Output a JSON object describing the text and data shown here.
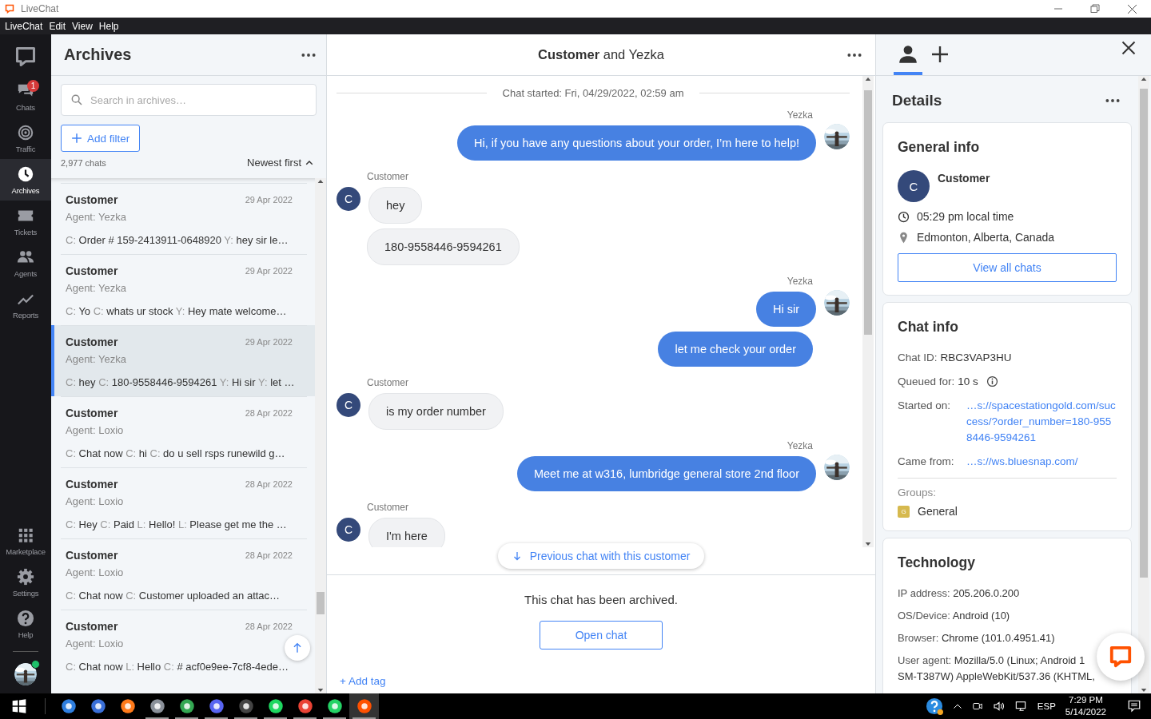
{
  "window": {
    "title": "LiveChat"
  },
  "menu": [
    "LiveChat",
    "Edit",
    "View",
    "Help"
  ],
  "nav": {
    "top": [
      {
        "kind": "chats",
        "label": "Chats",
        "selected": false,
        "badge": "1"
      },
      {
        "kind": "traffic",
        "label": "Traffic",
        "selected": false
      },
      {
        "kind": "archives",
        "label": "Archives",
        "selected": true
      },
      {
        "kind": "tickets",
        "label": "Tickets",
        "selected": false
      },
      {
        "kind": "agents",
        "label": "Agents",
        "selected": false
      },
      {
        "kind": "reports",
        "label": "Reports",
        "selected": false
      }
    ],
    "bottom": [
      {
        "kind": "marketplace",
        "label": "Marketplace",
        "selected": false
      },
      {
        "kind": "settings",
        "label": "Settings",
        "selected": false
      },
      {
        "kind": "help",
        "label": "Help",
        "selected": false
      }
    ],
    "agent_online": true
  },
  "archives": {
    "title": "Archives",
    "search_placeholder": "Search in archives…",
    "filter_button": "Add filter",
    "count": "2,977 chats",
    "sort": "Newest first",
    "items": [
      {
        "name": "Customer",
        "date": "29 Apr 2022",
        "agent": "Agent: Yezka",
        "selected": false,
        "preview": [
          {
            "who": "C:",
            "text": "Order # 159-2413911-0648920"
          },
          {
            "who": "Y:",
            "text": "hey sir le…"
          }
        ]
      },
      {
        "name": "Customer",
        "date": "29 Apr 2022",
        "agent": "Agent: Yezka",
        "selected": false,
        "preview": [
          {
            "who": "C:",
            "text": "Yo"
          },
          {
            "who": "C:",
            "text": "whats ur stock"
          },
          {
            "who": "Y:",
            "text": "Hey mate welcome…"
          }
        ]
      },
      {
        "name": "Customer",
        "date": "29 Apr 2022",
        "agent": "Agent: Yezka",
        "selected": true,
        "preview": [
          {
            "who": "C:",
            "text": "hey"
          },
          {
            "who": "C:",
            "text": "180-9558446-9594261"
          },
          {
            "who": "Y:",
            "text": "Hi sir"
          },
          {
            "who": "Y:",
            "text": "let …"
          }
        ]
      },
      {
        "name": "Customer",
        "date": "28 Apr 2022",
        "agent": "Agent: Loxio",
        "selected": false,
        "preview": [
          {
            "who": "C:",
            "text": "Chat now"
          },
          {
            "who": "C:",
            "text": "hi"
          },
          {
            "who": "C:",
            "text": "do u sell rsps runewild g…"
          }
        ]
      },
      {
        "name": "Customer",
        "date": "28 Apr 2022",
        "agent": "Agent: Loxio",
        "selected": false,
        "preview": [
          {
            "who": "C:",
            "text": "Hey"
          },
          {
            "who": "C:",
            "text": "Paid"
          },
          {
            "who": "L:",
            "text": "Hello!"
          },
          {
            "who": "L:",
            "text": "Please get me the …"
          }
        ]
      },
      {
        "name": "Customer",
        "date": "28 Apr 2022",
        "agent": "Agent: Loxio",
        "selected": false,
        "preview": [
          {
            "who": "C:",
            "text": "Chat now"
          },
          {
            "who": "C:",
            "text": "Customer uploaded an attac…"
          }
        ]
      },
      {
        "name": "Customer",
        "date": "28 Apr 2022",
        "agent": "Agent: Loxio",
        "selected": false,
        "preview": [
          {
            "who": "C:",
            "text": "Chat now"
          },
          {
            "who": "L:",
            "text": "Hello"
          },
          {
            "who": "C:",
            "text": "# acf0e9ee-7cf8-4ede…"
          }
        ]
      }
    ]
  },
  "chat": {
    "title": "**Customer** and Yezka",
    "started": "Chat started: Fri, 04/29/2022, 02:59 am",
    "groups": [
      {
        "kind": "agent",
        "author": "Yezka",
        "messages": [
          "Hi, if you have any questions about your order, I’m here to help!"
        ]
      },
      {
        "kind": "customer",
        "author": "Customer",
        "avatar": "C",
        "messages": [
          "hey",
          "180-9558446-9594261"
        ]
      },
      {
        "kind": "agent",
        "author": "Yezka",
        "messages": [
          "Hi sir",
          "let me check your order"
        ]
      },
      {
        "kind": "customer",
        "author": "Customer",
        "avatar": "C",
        "messages": [
          "is my order number"
        ]
      },
      {
        "kind": "agent",
        "author": "Yezka",
        "messages": [
          "Meet me at w316, lumbridge general store 2nd floor"
        ]
      },
      {
        "kind": "customer",
        "author": "Customer",
        "avatar": "C",
        "messages": [
          "I'm here"
        ]
      }
    ],
    "previous_button": "Previous chat with this customer",
    "archived_note": "This chat has been archived.",
    "open_button": "Open chat",
    "add_tag": "+ Add tag"
  },
  "details": {
    "tabs": [
      {
        "kind": "person",
        "selected": true
      },
      {
        "kind": "add",
        "selected": false
      }
    ],
    "title": "Details",
    "general": {
      "title": "General info",
      "avatar": "C",
      "name": "Customer",
      "local_time": "05:29 pm local time",
      "location": "Edmonton, Alberta, Canada",
      "button": "View all chats"
    },
    "chat_info": {
      "title": "Chat info",
      "rows": [
        {
          "kind": "text",
          "label": "Chat ID:",
          "value": "RBC3VAP3HU"
        },
        {
          "kind": "info",
          "label": "Queued for:",
          "value": "10 s"
        },
        {
          "kind": "link",
          "label": "Started on:",
          "value": "…s://spacestationgold.com/success/?order_number=180-9558446-9594261"
        },
        {
          "kind": "link",
          "label": "Came from:",
          "value": "…s://ws.bluesnap.com/"
        }
      ],
      "groups_label": "Groups:",
      "groups": [
        {
          "letter": "G",
          "name": "General",
          "color": "#d6b94e"
        }
      ]
    },
    "technology": {
      "title": "Technology",
      "rows": [
        {
          "label": "IP address:",
          "value": "205.206.0.200"
        },
        {
          "label": "OS/Device:",
          "value": "Android (10)"
        },
        {
          "label": "Browser:",
          "value": "Chrome (101.0.4951.41)"
        },
        {
          "label": "User agent:",
          "value": "Mozilla/5.0 (Linux; Android 1\nSM-T387W) AppleWebKit/537.36 (KHTML,"
        }
      ]
    }
  },
  "taskbar": {
    "apps": [
      {
        "color": "#2f7fe0",
        "running": false,
        "selected": false
      },
      {
        "color": "#3a6fd8",
        "running": false,
        "selected": false
      },
      {
        "color": "#ff7a1a",
        "running": false,
        "selected": false
      },
      {
        "color": "#8a9099",
        "running": true,
        "selected": false
      },
      {
        "color": "#34a853",
        "running": true,
        "selected": false
      },
      {
        "color": "#5865f2",
        "running": true,
        "selected": false
      },
      {
        "color": "#444444",
        "running": true,
        "selected": false
      },
      {
        "color": "#1ed760",
        "running": true,
        "selected": false
      },
      {
        "color": "#ea4335",
        "running": true,
        "selected": false
      },
      {
        "color": "#25d366",
        "running": true,
        "selected": false
      },
      {
        "color": "#ff5100",
        "running": true,
        "selected": true
      }
    ],
    "language": "ESP",
    "time": "7:29 PM",
    "date": "5/14/2022"
  }
}
